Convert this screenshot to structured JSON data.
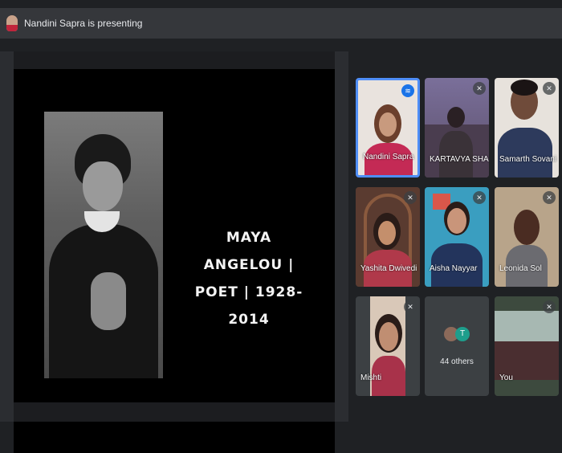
{
  "banner": {
    "presenter_text": "Nandini Sapra is presenting"
  },
  "slide": {
    "line1": "MAYA ANGELOU |",
    "line2": "POET | 1928-2014"
  },
  "participants": [
    {
      "name": "Nandini Sapra",
      "status": "speaking"
    },
    {
      "name": "KARTAVYA SHA...",
      "status": "muted"
    },
    {
      "name": "Samarth Sovani",
      "status": "muted"
    },
    {
      "name": "Yashita Dwivedi",
      "status": "muted"
    },
    {
      "name": "Aisha Nayyar",
      "status": "muted"
    },
    {
      "name": "Leonida Sol",
      "status": "muted"
    },
    {
      "name": "Mishti",
      "status": "muted"
    },
    {
      "name": "44 others",
      "initial": "T"
    },
    {
      "name": "You",
      "status": "muted"
    }
  ],
  "colors": {
    "accent": "#4f8ef7",
    "tile": "#3c4043",
    "background": "#1f2124"
  },
  "icons": {
    "speaking": "audio-wave-icon",
    "muted": "mic-off-icon"
  }
}
